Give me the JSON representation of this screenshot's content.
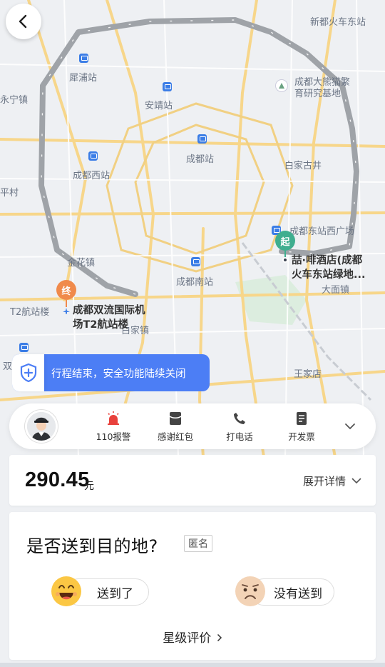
{
  "map": {
    "labels": {
      "xinduhuochedongzhan": "新都火车东站",
      "pupuzhan": "犀浦站",
      "yongningzhen": "永宁镇",
      "anjingzhan": "安靖站",
      "panda1": "成都大熊猫繁",
      "panda2": "育研究基地",
      "chengduzhan": "成都站",
      "baijiagujing": "白家古井",
      "chengduxizhan": "成都西站",
      "pingcun": "平村",
      "dongzhanxiguangchang": "成都东站西广场",
      "jinhuazhen": "金花镇",
      "chengdunanzhan": "成都南站",
      "damianzhen": "大面镇",
      "t2hangzhanlou": "T2航站楼",
      "baijiazhen": "白家镇",
      "wangjiadian": "王家店",
      "shuang": "双"
    },
    "pin_start": "起",
    "pin_end": "终",
    "dest_name_line1": "成都双流国际机",
    "dest_name_line2": "场T2航站楼",
    "origin_name_line1": "喆·啡酒店(成都",
    "origin_name_line2": "火车东站绿地..."
  },
  "safety_banner": {
    "text": "行程结束，安全功能陆续关闭",
    "icon": "shield-plus-icon"
  },
  "action_bar": {
    "items": [
      {
        "label": "110报警",
        "icon": "alarm-icon"
      },
      {
        "label": "感谢红包",
        "icon": "red-packet-icon"
      },
      {
        "label": "打电话",
        "icon": "phone-icon"
      },
      {
        "label": "开发票",
        "icon": "invoice-icon"
      }
    ],
    "more_icon": "chevron-down-icon"
  },
  "fare": {
    "amount": "290.45",
    "unit": "元",
    "expand_label": "展开详情"
  },
  "survey": {
    "question": "是否送到目的地?",
    "anonymous_tag": "匿名",
    "yes_label": "送到了",
    "no_label": "没有送到",
    "rating_label": "星级评价"
  },
  "colors": {
    "accent_blue": "#4c7ef5",
    "route_gray": "#9fa3a8",
    "start_pin": "#3fae8f",
    "end_pin": "#f08a4b"
  }
}
